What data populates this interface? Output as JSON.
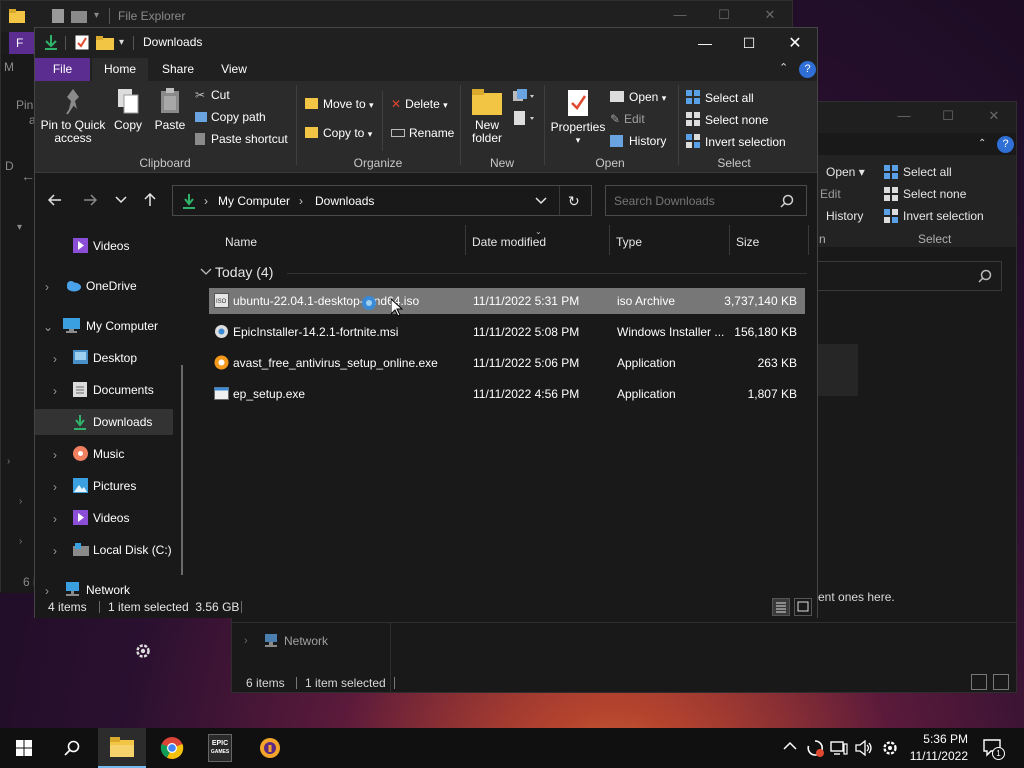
{
  "background_window_1": {
    "title": "File Explorer",
    "tab_file": "F",
    "left_labels": [
      "M",
      "Pin",
      "a",
      "D",
      "6 i"
    ]
  },
  "background_window_2": {
    "ribbon": {
      "open": "Open",
      "edit": "Edit",
      "history": "History",
      "select_all": "Select all",
      "select_none": "Select none",
      "invert_selection": "Invert selection",
      "group_select": "Select",
      "group_open_partial": "n"
    },
    "content_text": "ent ones here.",
    "nav_network": "Network",
    "status": {
      "items": "6 items",
      "selected": "1 item selected"
    }
  },
  "main_window": {
    "title": "Downloads",
    "tabs": {
      "file": "File",
      "home": "Home",
      "share": "Share",
      "view": "View"
    },
    "ribbon": {
      "clipboard": {
        "pin_line1": "Pin to Quick",
        "pin_line2": "access",
        "copy": "Copy",
        "paste": "Paste",
        "cut": "Cut",
        "copy_path": "Copy path",
        "paste_shortcut": "Paste shortcut",
        "label": "Clipboard"
      },
      "organize": {
        "move_to": "Move to",
        "copy_to": "Copy to",
        "delete": "Delete",
        "rename": "Rename",
        "label": "Organize"
      },
      "new": {
        "new_folder_line1": "New",
        "new_folder_line2": "folder",
        "label": "New"
      },
      "open": {
        "properties": "Properties",
        "open": "Open",
        "edit": "Edit",
        "history": "History",
        "label": "Open"
      },
      "select": {
        "select_all": "Select all",
        "select_none": "Select none",
        "invert_selection": "Invert selection",
        "label": "Select"
      }
    },
    "address": {
      "segments": [
        "My Computer",
        "Downloads"
      ]
    },
    "search": {
      "placeholder": "Search Downloads"
    },
    "nav_items": [
      {
        "label": "Videos",
        "icon": "videos-icon"
      },
      {
        "label": "OneDrive",
        "icon": "cloud-icon"
      },
      {
        "label": "My Computer",
        "icon": "computer-icon"
      },
      {
        "label": "Desktop",
        "icon": "desktop-icon"
      },
      {
        "label": "Documents",
        "icon": "documents-icon"
      },
      {
        "label": "Downloads",
        "icon": "download-icon"
      },
      {
        "label": "Music",
        "icon": "music-icon"
      },
      {
        "label": "Pictures",
        "icon": "pictures-icon"
      },
      {
        "label": "Videos",
        "icon": "videos-icon"
      },
      {
        "label": "Local Disk (C:)",
        "icon": "drive-icon"
      },
      {
        "label": "Network",
        "icon": "network-icon"
      }
    ],
    "columns": {
      "name": "Name",
      "date": "Date modified",
      "type": "Type",
      "size": "Size"
    },
    "group_header": "Today (4)",
    "files": [
      {
        "name": "ubuntu-22.04.1-desktop-amd64.iso",
        "date": "11/11/2022 5:31 PM",
        "type": "iso Archive",
        "size": "3,737,140 KB"
      },
      {
        "name": "EpicInstaller-14.2.1-fortnite.msi",
        "date": "11/11/2022 5:08 PM",
        "type": "Windows Installer ...",
        "size": "156,180 KB"
      },
      {
        "name": "avast_free_antivirus_setup_online.exe",
        "date": "11/11/2022 5:06 PM",
        "type": "Application",
        "size": "263 KB"
      },
      {
        "name": "ep_setup.exe",
        "date": "11/11/2022 4:56 PM",
        "type": "Application",
        "size": "1,807 KB"
      }
    ],
    "status": {
      "items": "4 items",
      "selected": "1 item selected  3.56 GB"
    }
  },
  "taskbar": {
    "time": "5:36 PM",
    "date": "11/11/2022",
    "notification_count": "1",
    "epic_label_1": "EPIC",
    "epic_label_2": "GAMES"
  },
  "colors": {
    "accent_file_tab": "#5c2d91",
    "selected_row": "#777777",
    "download_green": "#2fb36a",
    "folder_yellow": "#f3c545"
  }
}
